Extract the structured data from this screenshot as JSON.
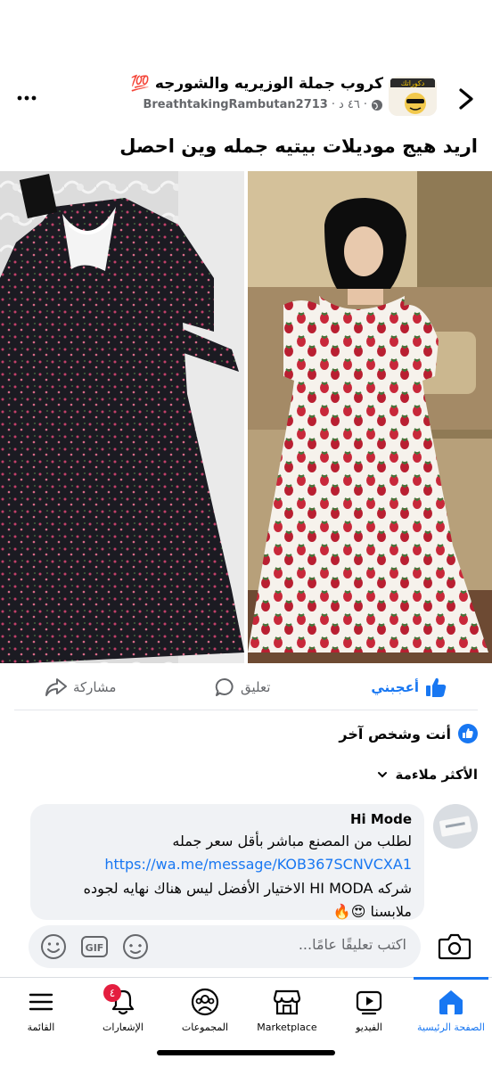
{
  "header": {
    "group_name": "كروب جملة الوزيريه والشورجه 💯",
    "author": "BreathtakingRambutan2713",
    "time": "٤٦ د",
    "dot": "·",
    "avatar_text": "دكوراتك"
  },
  "post": {
    "text": "اريد هيج موديلات بيتيه جمله وين احصل"
  },
  "actions": {
    "like": "أعجبني",
    "comment": "تعليق",
    "share": "مشاركة"
  },
  "reactions": {
    "summary": "أنت وشخص آخر"
  },
  "sort": {
    "label": "الأكثر ملاءمة"
  },
  "comment": {
    "name": "Hi Mode",
    "line1": "لطلب من المصنع مباشر بأقل سعر جمله",
    "link": "https://wa.me/message/KOB367SCNVCXA1",
    "line3": "شركه HI MODA الاختيار الأفضل ليس هناك نهايه لجوده",
    "line4": "ملابسنا 😍🔥"
  },
  "composer": {
    "placeholder": "اكتب تعليقًا عامًا...",
    "gif": "GIF"
  },
  "nav": {
    "home": "الصفحة الرئيسية",
    "video": "الفيديو",
    "marketplace": "Marketplace",
    "groups": "المجموعات",
    "notifications": "الإشعارات",
    "menu": "القائمة",
    "badge": "٤"
  },
  "colors": {
    "accent": "#1877f2",
    "badge": "#e41e3f",
    "bubble": "#f0f2f5"
  }
}
